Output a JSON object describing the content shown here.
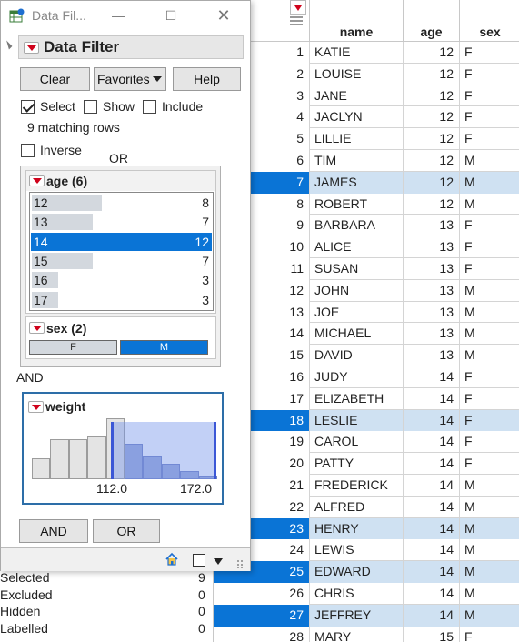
{
  "window": {
    "title": "Data Fil..."
  },
  "filter": {
    "header": "Data Filter",
    "clear_label": "Clear",
    "favorites_label": "Favorites",
    "help_label": "Help",
    "select_label": "Select",
    "show_label": "Show",
    "include_label": "Include",
    "select_checked": true,
    "show_checked": false,
    "include_checked": false,
    "matching": "9 matching rows",
    "inverse_label": "Inverse",
    "or_label": "OR",
    "and_label": "AND",
    "age": {
      "title": "age (6)",
      "items": [
        {
          "label": "12",
          "count": "8",
          "frac": 0.667,
          "selected": false
        },
        {
          "label": "13",
          "count": "7",
          "frac": 0.583,
          "selected": false
        },
        {
          "label": "14",
          "count": "12",
          "frac": 1.0,
          "selected": true
        },
        {
          "label": "15",
          "count": "7",
          "frac": 0.583,
          "selected": false
        },
        {
          "label": "16",
          "count": "3",
          "frac": 0.25,
          "selected": false
        },
        {
          "label": "17",
          "count": "3",
          "frac": 0.25,
          "selected": false
        }
      ]
    },
    "sex": {
      "title": "sex (2)",
      "f": "F",
      "m": "M"
    },
    "weight": {
      "title": "weight",
      "min_label": "112.0",
      "max_label": "172.0",
      "histogram": [
        {
          "h": 0.35,
          "in": false
        },
        {
          "h": 0.65,
          "in": false
        },
        {
          "h": 0.65,
          "in": false
        },
        {
          "h": 0.7,
          "in": false
        },
        {
          "h": 1.0,
          "in": false
        },
        {
          "h": 0.58,
          "in": true
        },
        {
          "h": 0.38,
          "in": true
        },
        {
          "h": 0.25,
          "in": true
        },
        {
          "h": 0.13,
          "in": true
        },
        {
          "h": 0.05,
          "in": true
        }
      ]
    },
    "and_button": "AND",
    "or_button": "OR"
  },
  "summary": [
    {
      "label": "Selected",
      "value": "9"
    },
    {
      "label": "Excluded",
      "value": "0"
    },
    {
      "label": "Hidden",
      "value": "0"
    },
    {
      "label": "Labelled",
      "value": "0"
    }
  ],
  "table": {
    "columns": [
      "name",
      "age",
      "sex"
    ],
    "rows": [
      {
        "n": "1",
        "name": "KATIE",
        "age": "12",
        "sex": "F",
        "sel": false
      },
      {
        "n": "2",
        "name": "LOUISE",
        "age": "12",
        "sex": "F",
        "sel": false
      },
      {
        "n": "3",
        "name": "JANE",
        "age": "12",
        "sex": "F",
        "sel": false
      },
      {
        "n": "4",
        "name": "JACLYN",
        "age": "12",
        "sex": "F",
        "sel": false
      },
      {
        "n": "5",
        "name": "LILLIE",
        "age": "12",
        "sex": "F",
        "sel": false
      },
      {
        "n": "6",
        "name": "TIM",
        "age": "12",
        "sex": "M",
        "sel": false
      },
      {
        "n": "7",
        "name": "JAMES",
        "age": "12",
        "sex": "M",
        "sel": true
      },
      {
        "n": "8",
        "name": "ROBERT",
        "age": "12",
        "sex": "M",
        "sel": false
      },
      {
        "n": "9",
        "name": "BARBARA",
        "age": "13",
        "sex": "F",
        "sel": false
      },
      {
        "n": "10",
        "name": "ALICE",
        "age": "13",
        "sex": "F",
        "sel": false
      },
      {
        "n": "11",
        "name": "SUSAN",
        "age": "13",
        "sex": "F",
        "sel": false
      },
      {
        "n": "12",
        "name": "JOHN",
        "age": "13",
        "sex": "M",
        "sel": false
      },
      {
        "n": "13",
        "name": "JOE",
        "age": "13",
        "sex": "M",
        "sel": false
      },
      {
        "n": "14",
        "name": "MICHAEL",
        "age": "13",
        "sex": "M",
        "sel": false
      },
      {
        "n": "15",
        "name": "DAVID",
        "age": "13",
        "sex": "M",
        "sel": false
      },
      {
        "n": "16",
        "name": "JUDY",
        "age": "14",
        "sex": "F",
        "sel": false
      },
      {
        "n": "17",
        "name": "ELIZABETH",
        "age": "14",
        "sex": "F",
        "sel": false
      },
      {
        "n": "18",
        "name": "LESLIE",
        "age": "14",
        "sex": "F",
        "sel": true
      },
      {
        "n": "19",
        "name": "CAROL",
        "age": "14",
        "sex": "F",
        "sel": false
      },
      {
        "n": "20",
        "name": "PATTY",
        "age": "14",
        "sex": "F",
        "sel": false
      },
      {
        "n": "21",
        "name": "FREDERICK",
        "age": "14",
        "sex": "M",
        "sel": false
      },
      {
        "n": "22",
        "name": "ALFRED",
        "age": "14",
        "sex": "M",
        "sel": false
      },
      {
        "n": "23",
        "name": "HENRY",
        "age": "14",
        "sex": "M",
        "sel": true
      },
      {
        "n": "24",
        "name": "LEWIS",
        "age": "14",
        "sex": "M",
        "sel": false
      },
      {
        "n": "25",
        "name": "EDWARD",
        "age": "14",
        "sex": "M",
        "sel": true
      },
      {
        "n": "26",
        "name": "CHRIS",
        "age": "14",
        "sex": "M",
        "sel": false
      },
      {
        "n": "27",
        "name": "JEFFREY",
        "age": "14",
        "sex": "M",
        "sel": true
      },
      {
        "n": "28",
        "name": "MARY",
        "age": "15",
        "sex": "F",
        "sel": false
      }
    ]
  },
  "colors": {
    "selection": "#0a74d6",
    "selection_light": "#cfe1f2",
    "menu_red": "#d0021b"
  }
}
